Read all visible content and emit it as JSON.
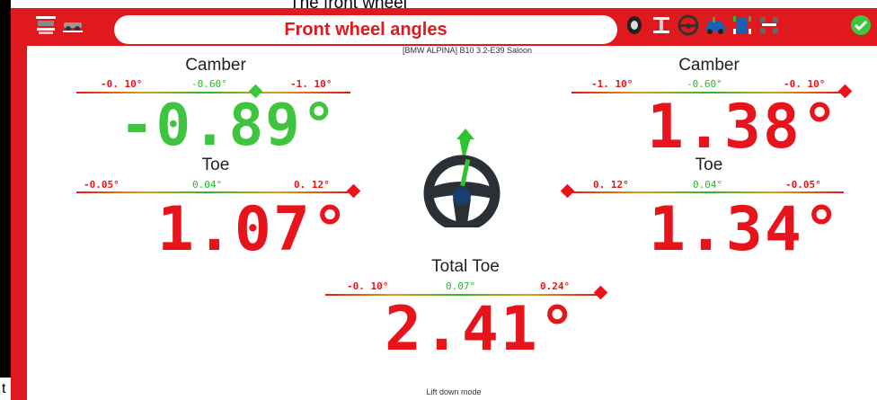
{
  "header": {
    "top_caption": "The front wheel",
    "title": "Front wheel angles",
    "vehicle": "[BMW ALPINA] B10 3.2-E39 Saloon",
    "left_icons": [
      "lift-icon",
      "car-side-icon"
    ],
    "right_icons": [
      "tyre-icon",
      "lift-axle-icon",
      "steering-wheel-icon",
      "car-icon",
      "car-sensors-icon",
      "axle-icon",
      "confirm-icon"
    ]
  },
  "left": {
    "camber_label": "Camber",
    "camber_tol_min": "-0. 10°",
    "camber_tol_nom": "-0.60°",
    "camber_tol_max": "-1. 10°",
    "camber_value": "-0.89°",
    "toe_label": "Toe",
    "toe_tol_min": "-0.05°",
    "toe_tol_nom": "0.04°",
    "toe_tol_max": "0. 12°",
    "toe_value": "1.07°"
  },
  "right": {
    "camber_label": "Camber",
    "camber_tol_min": "-1. 10°",
    "camber_tol_nom": "-0.60°",
    "camber_tol_max": "-0. 10°",
    "camber_value": "1.38°",
    "toe_label": "Toe",
    "toe_tol_min": "0. 12°",
    "toe_tol_nom": "0.04°",
    "toe_tol_max": "-0.05°",
    "toe_value": "1.34°"
  },
  "total": {
    "label": "Total Toe",
    "tol_min": "-0. 10°",
    "tol_nom": "0.07°",
    "tol_max": "0.24°",
    "value": "2.41°"
  },
  "footer": {
    "mode": "Lift down mode",
    "left_letter": "t"
  },
  "colors": {
    "frame": "#e0191e",
    "in_tolerance": "#2fb52f",
    "out_of_tolerance": "#e8141b"
  }
}
